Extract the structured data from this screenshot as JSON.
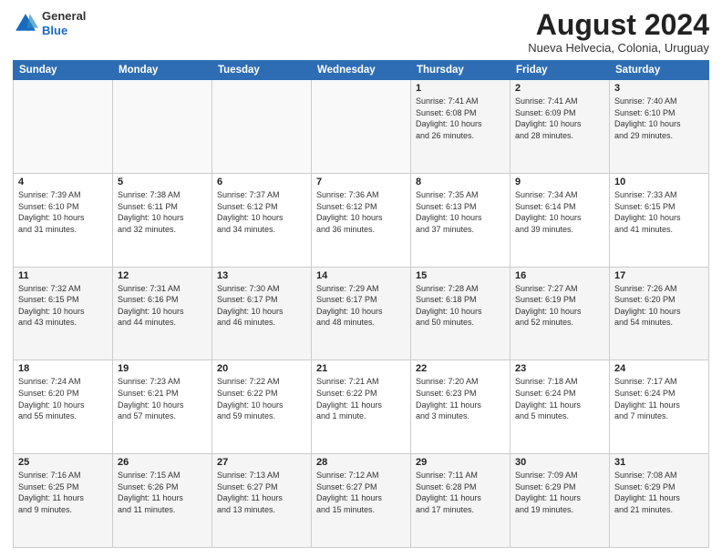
{
  "header": {
    "logo": {
      "general": "General",
      "blue": "Blue"
    },
    "title": "August 2024",
    "location": "Nueva Helvecia, Colonia, Uruguay"
  },
  "days_of_week": [
    "Sunday",
    "Monday",
    "Tuesday",
    "Wednesday",
    "Thursday",
    "Friday",
    "Saturday"
  ],
  "weeks": [
    [
      {
        "day": "",
        "info": ""
      },
      {
        "day": "",
        "info": ""
      },
      {
        "day": "",
        "info": ""
      },
      {
        "day": "",
        "info": ""
      },
      {
        "day": "1",
        "info": "Sunrise: 7:41 AM\nSunset: 6:08 PM\nDaylight: 10 hours\nand 26 minutes."
      },
      {
        "day": "2",
        "info": "Sunrise: 7:41 AM\nSunset: 6:09 PM\nDaylight: 10 hours\nand 28 minutes."
      },
      {
        "day": "3",
        "info": "Sunrise: 7:40 AM\nSunset: 6:10 PM\nDaylight: 10 hours\nand 29 minutes."
      }
    ],
    [
      {
        "day": "4",
        "info": "Sunrise: 7:39 AM\nSunset: 6:10 PM\nDaylight: 10 hours\nand 31 minutes."
      },
      {
        "day": "5",
        "info": "Sunrise: 7:38 AM\nSunset: 6:11 PM\nDaylight: 10 hours\nand 32 minutes."
      },
      {
        "day": "6",
        "info": "Sunrise: 7:37 AM\nSunset: 6:12 PM\nDaylight: 10 hours\nand 34 minutes."
      },
      {
        "day": "7",
        "info": "Sunrise: 7:36 AM\nSunset: 6:12 PM\nDaylight: 10 hours\nand 36 minutes."
      },
      {
        "day": "8",
        "info": "Sunrise: 7:35 AM\nSunset: 6:13 PM\nDaylight: 10 hours\nand 37 minutes."
      },
      {
        "day": "9",
        "info": "Sunrise: 7:34 AM\nSunset: 6:14 PM\nDaylight: 10 hours\nand 39 minutes."
      },
      {
        "day": "10",
        "info": "Sunrise: 7:33 AM\nSunset: 6:15 PM\nDaylight: 10 hours\nand 41 minutes."
      }
    ],
    [
      {
        "day": "11",
        "info": "Sunrise: 7:32 AM\nSunset: 6:15 PM\nDaylight: 10 hours\nand 43 minutes."
      },
      {
        "day": "12",
        "info": "Sunrise: 7:31 AM\nSunset: 6:16 PM\nDaylight: 10 hours\nand 44 minutes."
      },
      {
        "day": "13",
        "info": "Sunrise: 7:30 AM\nSunset: 6:17 PM\nDaylight: 10 hours\nand 46 minutes."
      },
      {
        "day": "14",
        "info": "Sunrise: 7:29 AM\nSunset: 6:17 PM\nDaylight: 10 hours\nand 48 minutes."
      },
      {
        "day": "15",
        "info": "Sunrise: 7:28 AM\nSunset: 6:18 PM\nDaylight: 10 hours\nand 50 minutes."
      },
      {
        "day": "16",
        "info": "Sunrise: 7:27 AM\nSunset: 6:19 PM\nDaylight: 10 hours\nand 52 minutes."
      },
      {
        "day": "17",
        "info": "Sunrise: 7:26 AM\nSunset: 6:20 PM\nDaylight: 10 hours\nand 54 minutes."
      }
    ],
    [
      {
        "day": "18",
        "info": "Sunrise: 7:24 AM\nSunset: 6:20 PM\nDaylight: 10 hours\nand 55 minutes."
      },
      {
        "day": "19",
        "info": "Sunrise: 7:23 AM\nSunset: 6:21 PM\nDaylight: 10 hours\nand 57 minutes."
      },
      {
        "day": "20",
        "info": "Sunrise: 7:22 AM\nSunset: 6:22 PM\nDaylight: 10 hours\nand 59 minutes."
      },
      {
        "day": "21",
        "info": "Sunrise: 7:21 AM\nSunset: 6:22 PM\nDaylight: 11 hours\nand 1 minute."
      },
      {
        "day": "22",
        "info": "Sunrise: 7:20 AM\nSunset: 6:23 PM\nDaylight: 11 hours\nand 3 minutes."
      },
      {
        "day": "23",
        "info": "Sunrise: 7:18 AM\nSunset: 6:24 PM\nDaylight: 11 hours\nand 5 minutes."
      },
      {
        "day": "24",
        "info": "Sunrise: 7:17 AM\nSunset: 6:24 PM\nDaylight: 11 hours\nand 7 minutes."
      }
    ],
    [
      {
        "day": "25",
        "info": "Sunrise: 7:16 AM\nSunset: 6:25 PM\nDaylight: 11 hours\nand 9 minutes."
      },
      {
        "day": "26",
        "info": "Sunrise: 7:15 AM\nSunset: 6:26 PM\nDaylight: 11 hours\nand 11 minutes."
      },
      {
        "day": "27",
        "info": "Sunrise: 7:13 AM\nSunset: 6:27 PM\nDaylight: 11 hours\nand 13 minutes."
      },
      {
        "day": "28",
        "info": "Sunrise: 7:12 AM\nSunset: 6:27 PM\nDaylight: 11 hours\nand 15 minutes."
      },
      {
        "day": "29",
        "info": "Sunrise: 7:11 AM\nSunset: 6:28 PM\nDaylight: 11 hours\nand 17 minutes."
      },
      {
        "day": "30",
        "info": "Sunrise: 7:09 AM\nSunset: 6:29 PM\nDaylight: 11 hours\nand 19 minutes."
      },
      {
        "day": "31",
        "info": "Sunrise: 7:08 AM\nSunset: 6:29 PM\nDaylight: 11 hours\nand 21 minutes."
      }
    ]
  ]
}
